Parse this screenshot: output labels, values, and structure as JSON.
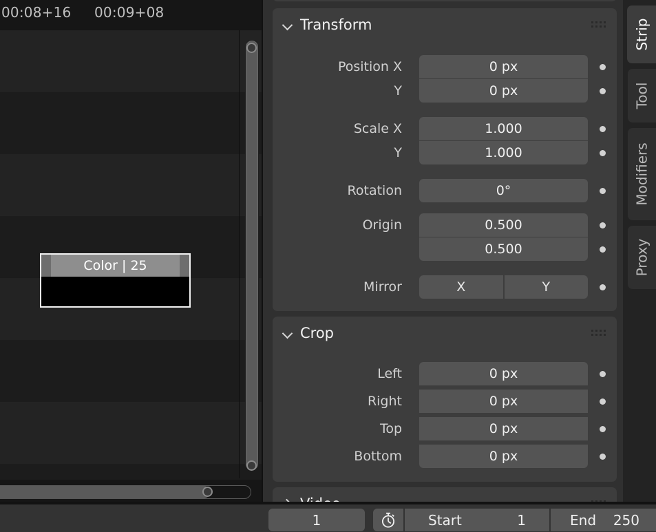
{
  "timeline": {
    "timecodes": [
      "00:08+16",
      "00:09+08"
    ],
    "strip": {
      "label": "Color | 25",
      "name_icon": "strip-handle"
    },
    "scrollbar_v": "vertical-scrollbar",
    "scrollbar_h": "horizontal-scrollbar"
  },
  "properties": {
    "panels": [
      {
        "id": "transform",
        "title": "Transform",
        "chevron": "chevron-down-icon",
        "grip": "grip-dots-icon",
        "rows": [
          {
            "label": "Position X",
            "value": "0 px",
            "shape": "rt"
          },
          {
            "label": "Y",
            "value": "0 px",
            "shape": "rb"
          },
          {
            "label": "Scale X",
            "value": "1.000",
            "shape": "rt"
          },
          {
            "label": "Y",
            "value": "1.000",
            "shape": "rb"
          },
          {
            "label": "Rotation",
            "value": "0°",
            "shape": "rtb"
          },
          {
            "label": "Origin",
            "value": "0.500",
            "shape": "rt"
          },
          {
            "label": "",
            "value": "0.500",
            "shape": "rb"
          }
        ],
        "mirror": {
          "label": "Mirror",
          "x": "X",
          "y": "Y"
        }
      },
      {
        "id": "crop",
        "title": "Crop",
        "chevron": "chevron-down-icon",
        "grip": "grip-dots-icon",
        "rows": [
          {
            "label": "Left",
            "value": "0 px",
            "shape": "rt"
          },
          {
            "label": "Right",
            "value": "0 px",
            "shape": "rnone"
          },
          {
            "label": "Top",
            "value": "0 px",
            "shape": "rnone"
          },
          {
            "label": "Bottom",
            "value": "0 px",
            "shape": "rb"
          }
        ]
      },
      {
        "id": "video",
        "title": "Video",
        "chevron": "chevron-right-icon",
        "grip": "grip-dots-icon",
        "rows": []
      }
    ]
  },
  "tabs": [
    {
      "label": "Strip",
      "active": true
    },
    {
      "label": "Tool",
      "active": false
    },
    {
      "label": "Modifiers",
      "active": false
    },
    {
      "label": "Proxy",
      "active": false
    }
  ],
  "footer": {
    "current_frame": "1",
    "timer_icon": "stopwatch-icon",
    "start_label": "Start",
    "start_value": "1",
    "end_label": "End",
    "end_value": "250"
  },
  "colors": {
    "panel_bg": "#3d3d3d",
    "field_bg": "#545454",
    "region_bg": "#303030",
    "timeline_bg": "#161616",
    "strip_title": "#8e8e8e",
    "accent_text": "#ffffff"
  }
}
